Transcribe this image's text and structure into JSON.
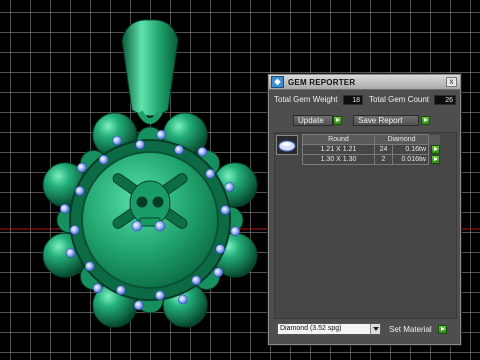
{
  "panel": {
    "title": "GEM REPORTER",
    "app_icon": "gem-reporter-app-icon",
    "close_label": "x",
    "total_weight_label": "Total Gem Weight",
    "total_weight_value": "18",
    "total_count_label": "Total Gem Count",
    "total_count_value": "26",
    "update_label": "Update",
    "save_report_label": "Save Report",
    "table": {
      "headers": [
        "Round",
        "Diamond"
      ],
      "rows": [
        {
          "size": "1.21 X 1.21",
          "count": "24",
          "weight": "0.16tw"
        },
        {
          "size": "1.30 X 1.30",
          "count": "2",
          "weight": "0.016tw"
        }
      ]
    },
    "material_value": "Diamond   (3.52 spg)",
    "set_material_label": "Set Material"
  },
  "colors": {
    "model_green": "#1e9e6b",
    "gem_blue": "#9bb6ff",
    "arrow_green": "#3aa21c"
  }
}
